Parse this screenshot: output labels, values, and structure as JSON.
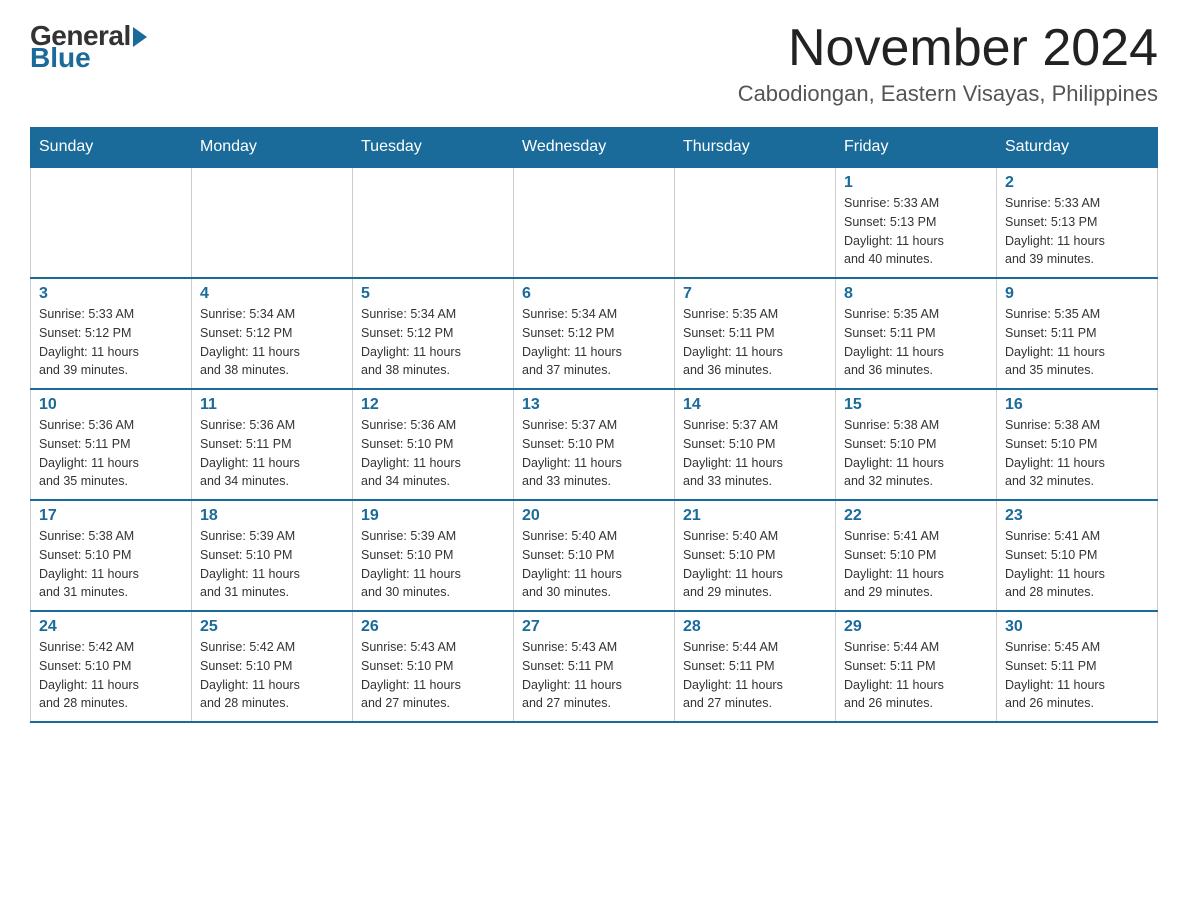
{
  "logo": {
    "general": "General",
    "blue": "Blue"
  },
  "title": {
    "month_year": "November 2024",
    "location": "Cabodiongan, Eastern Visayas, Philippines"
  },
  "days_header": [
    "Sunday",
    "Monday",
    "Tuesday",
    "Wednesday",
    "Thursday",
    "Friday",
    "Saturday"
  ],
  "weeks": [
    [
      {
        "day": "",
        "info": ""
      },
      {
        "day": "",
        "info": ""
      },
      {
        "day": "",
        "info": ""
      },
      {
        "day": "",
        "info": ""
      },
      {
        "day": "",
        "info": ""
      },
      {
        "day": "1",
        "info": "Sunrise: 5:33 AM\nSunset: 5:13 PM\nDaylight: 11 hours\nand 40 minutes."
      },
      {
        "day": "2",
        "info": "Sunrise: 5:33 AM\nSunset: 5:13 PM\nDaylight: 11 hours\nand 39 minutes."
      }
    ],
    [
      {
        "day": "3",
        "info": "Sunrise: 5:33 AM\nSunset: 5:12 PM\nDaylight: 11 hours\nand 39 minutes."
      },
      {
        "day": "4",
        "info": "Sunrise: 5:34 AM\nSunset: 5:12 PM\nDaylight: 11 hours\nand 38 minutes."
      },
      {
        "day": "5",
        "info": "Sunrise: 5:34 AM\nSunset: 5:12 PM\nDaylight: 11 hours\nand 38 minutes."
      },
      {
        "day": "6",
        "info": "Sunrise: 5:34 AM\nSunset: 5:12 PM\nDaylight: 11 hours\nand 37 minutes."
      },
      {
        "day": "7",
        "info": "Sunrise: 5:35 AM\nSunset: 5:11 PM\nDaylight: 11 hours\nand 36 minutes."
      },
      {
        "day": "8",
        "info": "Sunrise: 5:35 AM\nSunset: 5:11 PM\nDaylight: 11 hours\nand 36 minutes."
      },
      {
        "day": "9",
        "info": "Sunrise: 5:35 AM\nSunset: 5:11 PM\nDaylight: 11 hours\nand 35 minutes."
      }
    ],
    [
      {
        "day": "10",
        "info": "Sunrise: 5:36 AM\nSunset: 5:11 PM\nDaylight: 11 hours\nand 35 minutes."
      },
      {
        "day": "11",
        "info": "Sunrise: 5:36 AM\nSunset: 5:11 PM\nDaylight: 11 hours\nand 34 minutes."
      },
      {
        "day": "12",
        "info": "Sunrise: 5:36 AM\nSunset: 5:10 PM\nDaylight: 11 hours\nand 34 minutes."
      },
      {
        "day": "13",
        "info": "Sunrise: 5:37 AM\nSunset: 5:10 PM\nDaylight: 11 hours\nand 33 minutes."
      },
      {
        "day": "14",
        "info": "Sunrise: 5:37 AM\nSunset: 5:10 PM\nDaylight: 11 hours\nand 33 minutes."
      },
      {
        "day": "15",
        "info": "Sunrise: 5:38 AM\nSunset: 5:10 PM\nDaylight: 11 hours\nand 32 minutes."
      },
      {
        "day": "16",
        "info": "Sunrise: 5:38 AM\nSunset: 5:10 PM\nDaylight: 11 hours\nand 32 minutes."
      }
    ],
    [
      {
        "day": "17",
        "info": "Sunrise: 5:38 AM\nSunset: 5:10 PM\nDaylight: 11 hours\nand 31 minutes."
      },
      {
        "day": "18",
        "info": "Sunrise: 5:39 AM\nSunset: 5:10 PM\nDaylight: 11 hours\nand 31 minutes."
      },
      {
        "day": "19",
        "info": "Sunrise: 5:39 AM\nSunset: 5:10 PM\nDaylight: 11 hours\nand 30 minutes."
      },
      {
        "day": "20",
        "info": "Sunrise: 5:40 AM\nSunset: 5:10 PM\nDaylight: 11 hours\nand 30 minutes."
      },
      {
        "day": "21",
        "info": "Sunrise: 5:40 AM\nSunset: 5:10 PM\nDaylight: 11 hours\nand 29 minutes."
      },
      {
        "day": "22",
        "info": "Sunrise: 5:41 AM\nSunset: 5:10 PM\nDaylight: 11 hours\nand 29 minutes."
      },
      {
        "day": "23",
        "info": "Sunrise: 5:41 AM\nSunset: 5:10 PM\nDaylight: 11 hours\nand 28 minutes."
      }
    ],
    [
      {
        "day": "24",
        "info": "Sunrise: 5:42 AM\nSunset: 5:10 PM\nDaylight: 11 hours\nand 28 minutes."
      },
      {
        "day": "25",
        "info": "Sunrise: 5:42 AM\nSunset: 5:10 PM\nDaylight: 11 hours\nand 28 minutes."
      },
      {
        "day": "26",
        "info": "Sunrise: 5:43 AM\nSunset: 5:10 PM\nDaylight: 11 hours\nand 27 minutes."
      },
      {
        "day": "27",
        "info": "Sunrise: 5:43 AM\nSunset: 5:11 PM\nDaylight: 11 hours\nand 27 minutes."
      },
      {
        "day": "28",
        "info": "Sunrise: 5:44 AM\nSunset: 5:11 PM\nDaylight: 11 hours\nand 27 minutes."
      },
      {
        "day": "29",
        "info": "Sunrise: 5:44 AM\nSunset: 5:11 PM\nDaylight: 11 hours\nand 26 minutes."
      },
      {
        "day": "30",
        "info": "Sunrise: 5:45 AM\nSunset: 5:11 PM\nDaylight: 11 hours\nand 26 minutes."
      }
    ]
  ]
}
